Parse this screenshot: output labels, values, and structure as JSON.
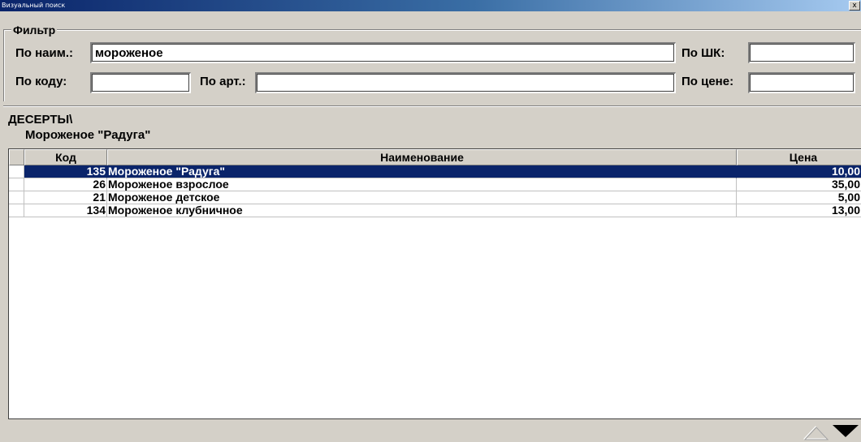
{
  "window": {
    "title": "Визуальный поиск",
    "close_label": "x"
  },
  "filter": {
    "legend": "Фильтр",
    "name_label": "По наим.:",
    "name_value": "мороженое",
    "barcode_label": "По ШК:",
    "barcode_value": "",
    "code_label": "По коду:",
    "code_value": "",
    "article_label": "По арт.:",
    "article_value": "",
    "price_label": "По цене:",
    "price_value": ""
  },
  "path": {
    "category": "ДЕСЕРТЫ\\",
    "selected_item": "Мороженое \"Радуга\""
  },
  "table": {
    "headers": {
      "code": "Код",
      "name": "Наименование",
      "price": "Цена"
    },
    "rows": [
      {
        "code": "135",
        "name": "Мороженое \"Радуга\"",
        "price": "10,00",
        "selected": true
      },
      {
        "code": "26",
        "name": "Мороженое взрослое",
        "price": "35,00",
        "selected": false
      },
      {
        "code": "21",
        "name": "Мороженое детское",
        "price": "5,00",
        "selected": false
      },
      {
        "code": "134",
        "name": "Мороженое клубничное",
        "price": "13,00",
        "selected": false
      }
    ]
  },
  "scroll": {
    "up_icon": "triangle-up-outline-icon",
    "down_icon": "triangle-down-filled-icon"
  },
  "colors": {
    "selection": "#0a246a",
    "face": "#d4d0c8"
  }
}
